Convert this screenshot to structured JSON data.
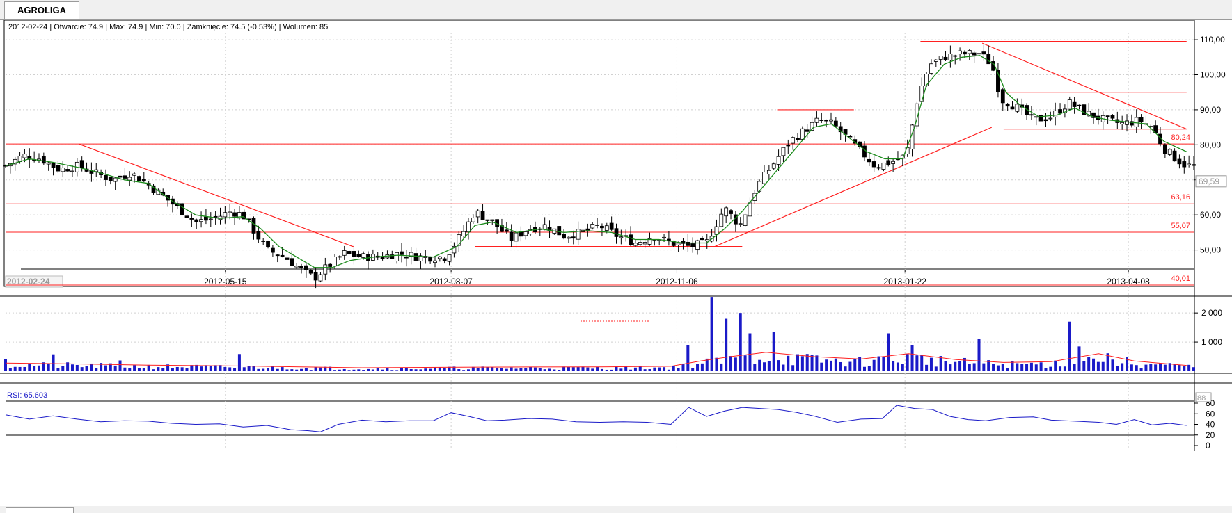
{
  "tab": {
    "label": "AGROLIGA"
  },
  "info_bar": {
    "text": "2012-02-24 | Otwarcie: 74.9 | Max: 74.9 | Min: 70.0 | Zamknięcie: 74.5 (-0.53%) | Wolumen: 85"
  },
  "chart_data": [
    {
      "type": "candlestick",
      "title": "",
      "ylim": [
        40,
        112
      ],
      "y_ticks": [
        "110,00",
        "100,00",
        "90,00",
        "80,00",
        "70,00",
        "60,00",
        "50,00"
      ],
      "x_ticks": [
        "2012-05-15",
        "2012-08-07",
        "2012-11-06",
        "2013-01-22",
        "2013-04-08"
      ],
      "x_start_label": "2012-02-24",
      "last_price_label": "69,59",
      "levels": [
        {
          "label": "80,24",
          "value": 80.24
        },
        {
          "label": "63,16",
          "value": 63.16
        },
        {
          "label": "55,07",
          "value": 55.07
        },
        {
          "label": "40,01",
          "value": 40.01
        }
      ],
      "trendlines": [
        {
          "from": [
            0.062,
            80.2
          ],
          "to": [
            0.293,
            50.9
          ]
        },
        {
          "from": [
            0.395,
            51.0
          ],
          "to": [
            0.62,
            51.0
          ]
        },
        {
          "from": [
            0.65,
            90.0
          ],
          "to": [
            0.714,
            90.0
          ]
        },
        {
          "from": [
            0.597,
            51.0
          ],
          "to": [
            0.83,
            85.0
          ]
        },
        {
          "from": [
            0.77,
            109.5
          ],
          "to": [
            0.994,
            109.5
          ]
        },
        {
          "from": [
            0.822,
            109.0
          ],
          "to": [
            0.994,
            84.5
          ]
        },
        {
          "from": [
            0.84,
            95.0
          ],
          "to": [
            0.994,
            95.0
          ]
        },
        {
          "from": [
            0.84,
            84.5
          ],
          "to": [
            0.994,
            84.5
          ]
        }
      ],
      "series": [
        {
          "name": "",
          "kind": "close",
          "points": [
            [
              0,
              74
            ],
            [
              0.015,
              77
            ],
            [
              0.03,
              76
            ],
            [
              0.045,
              73
            ],
            [
              0.062,
              74
            ],
            [
              0.075,
              72
            ],
            [
              0.09,
              70
            ],
            [
              0.105,
              72
            ],
            [
              0.115,
              70
            ],
            [
              0.13,
              66
            ],
            [
              0.145,
              62
            ],
            [
              0.16,
              58
            ],
            [
              0.175,
              59
            ],
            [
              0.19,
              61
            ],
            [
              0.2,
              60
            ],
            [
              0.21,
              55
            ],
            [
              0.22,
              50
            ],
            [
              0.235,
              48
            ],
            [
              0.25,
              44
            ],
            [
              0.26,
              42
            ],
            [
              0.27,
              45
            ],
            [
              0.285,
              49
            ],
            [
              0.3,
              48
            ],
            [
              0.315,
              48
            ],
            [
              0.33,
              49
            ],
            [
              0.35,
              48
            ],
            [
              0.37,
              48
            ],
            [
              0.385,
              55
            ],
            [
              0.395,
              61
            ],
            [
              0.41,
              58
            ],
            [
              0.425,
              53
            ],
            [
              0.44,
              56
            ],
            [
              0.455,
              57
            ],
            [
              0.47,
              54
            ],
            [
              0.485,
              55
            ],
            [
              0.5,
              57
            ],
            [
              0.515,
              54
            ],
            [
              0.53,
              52
            ],
            [
              0.545,
              54
            ],
            [
              0.56,
              52
            ],
            [
              0.575,
              51
            ],
            [
              0.59,
              52
            ],
            [
              0.605,
              62
            ],
            [
              0.618,
              57
            ],
            [
              0.632,
              68
            ],
            [
              0.645,
              74
            ],
            [
              0.66,
              81
            ],
            [
              0.672,
              84
            ],
            [
              0.684,
              87
            ],
            [
              0.696,
              86
            ],
            [
              0.708,
              82
            ],
            [
              0.72,
              78
            ],
            [
              0.732,
              74
            ],
            [
              0.745,
              75
            ],
            [
              0.758,
              77
            ],
            [
              0.768,
              94
            ],
            [
              0.778,
              103
            ],
            [
              0.79,
              105
            ],
            [
              0.805,
              106
            ],
            [
              0.82,
              106
            ],
            [
              0.83,
              103
            ],
            [
              0.838,
              93
            ],
            [
              0.85,
              91
            ],
            [
              0.865,
              87
            ],
            [
              0.88,
              88
            ],
            [
              0.895,
              92
            ],
            [
              0.91,
              89
            ],
            [
              0.925,
              87
            ],
            [
              0.94,
              86
            ],
            [
              0.955,
              87
            ],
            [
              0.965,
              85
            ],
            [
              0.975,
              79
            ],
            [
              0.985,
              76
            ],
            [
              0.994,
              74
            ]
          ]
        },
        {
          "name": "",
          "kind": "average",
          "points": [
            [
              0,
              74
            ],
            [
              0.02,
              76
            ],
            [
              0.04,
              75
            ],
            [
              0.062,
              73.5
            ],
            [
              0.08,
              72
            ],
            [
              0.1,
              70
            ],
            [
              0.12,
              69
            ],
            [
              0.14,
              64
            ],
            [
              0.16,
              60
            ],
            [
              0.18,
              59
            ],
            [
              0.2,
              59.5
            ],
            [
              0.215,
              56
            ],
            [
              0.23,
              51
            ],
            [
              0.245,
              48
            ],
            [
              0.26,
              45
            ],
            [
              0.275,
              45
            ],
            [
              0.29,
              47
            ],
            [
              0.31,
              48
            ],
            [
              0.33,
              48.5
            ],
            [
              0.36,
              48
            ],
            [
              0.38,
              51
            ],
            [
              0.395,
              57
            ],
            [
              0.41,
              58
            ],
            [
              0.43,
              55
            ],
            [
              0.45,
              56
            ],
            [
              0.47,
              55
            ],
            [
              0.49,
              55.5
            ],
            [
              0.51,
              55
            ],
            [
              0.53,
              53
            ],
            [
              0.55,
              53
            ],
            [
              0.57,
              52
            ],
            [
              0.59,
              52
            ],
            [
              0.605,
              56
            ],
            [
              0.62,
              61
            ],
            [
              0.635,
              67
            ],
            [
              0.65,
              73
            ],
            [
              0.665,
              79
            ],
            [
              0.68,
              85
            ],
            [
              0.695,
              86
            ],
            [
              0.71,
              82
            ],
            [
              0.725,
              78
            ],
            [
              0.74,
              76
            ],
            [
              0.755,
              76
            ],
            [
              0.765,
              85
            ],
            [
              0.775,
              97
            ],
            [
              0.79,
              103
            ],
            [
              0.805,
              105
            ],
            [
              0.82,
              105.5
            ],
            [
              0.832,
              103
            ],
            [
              0.842,
              95
            ],
            [
              0.855,
              91
            ],
            [
              0.87,
              88
            ],
            [
              0.885,
              88.5
            ],
            [
              0.9,
              90.5
            ],
            [
              0.915,
              88
            ],
            [
              0.93,
              87
            ],
            [
              0.945,
              86.5
            ],
            [
              0.96,
              86
            ],
            [
              0.975,
              81
            ],
            [
              0.994,
              78
            ]
          ]
        }
      ]
    },
    {
      "type": "bar",
      "title": "",
      "ylim": [
        0,
        2600
      ],
      "y_ticks": [
        "2 000",
        "1 000"
      ],
      "tick_values": [
        2000,
        1000
      ],
      "spikes": [
        [
          0.0,
          420
        ],
        [
          0.041,
          580
        ],
        [
          0.095,
          370
        ],
        [
          0.195,
          590
        ],
        [
          0.575,
          900
        ],
        [
          0.595,
          2550
        ],
        [
          0.606,
          1800
        ],
        [
          0.617,
          2000
        ],
        [
          0.627,
          1300
        ],
        [
          0.648,
          1350
        ],
        [
          0.742,
          1300
        ],
        [
          0.762,
          900
        ],
        [
          0.82,
          1100
        ],
        [
          0.896,
          1700
        ],
        [
          0.905,
          850
        ],
        [
          0.932,
          400
        ]
      ],
      "ma": [
        [
          0,
          280
        ],
        [
          0.06,
          250
        ],
        [
          0.12,
          210
        ],
        [
          0.2,
          180
        ],
        [
          0.3,
          120
        ],
        [
          0.4,
          140
        ],
        [
          0.5,
          150
        ],
        [
          0.56,
          170
        ],
        [
          0.585,
          350
        ],
        [
          0.61,
          500
        ],
        [
          0.64,
          650
        ],
        [
          0.68,
          500
        ],
        [
          0.72,
          420
        ],
        [
          0.76,
          600
        ],
        [
          0.8,
          400
        ],
        [
          0.84,
          300
        ],
        [
          0.88,
          330
        ],
        [
          0.92,
          600
        ],
        [
          0.95,
          350
        ],
        [
          0.994,
          200
        ]
      ]
    },
    {
      "type": "line",
      "title": "",
      "label": "RSI: 65.603",
      "value_badge": "88",
      "ylim": [
        0,
        80
      ],
      "y_ticks": [
        "80",
        "60",
        "40",
        "20",
        "0"
      ],
      "tick_values": [
        80,
        60,
        40,
        20,
        0
      ],
      "points": [
        [
          0,
          58
        ],
        [
          0.02,
          50
        ],
        [
          0.04,
          56
        ],
        [
          0.06,
          50
        ],
        [
          0.08,
          45
        ],
        [
          0.1,
          47
        ],
        [
          0.12,
          46
        ],
        [
          0.14,
          42
        ],
        [
          0.16,
          40
        ],
        [
          0.18,
          41
        ],
        [
          0.2,
          35
        ],
        [
          0.22,
          38
        ],
        [
          0.24,
          30
        ],
        [
          0.255,
          28
        ],
        [
          0.265,
          26
        ],
        [
          0.28,
          40
        ],
        [
          0.3,
          48
        ],
        [
          0.32,
          45
        ],
        [
          0.34,
          47
        ],
        [
          0.36,
          47
        ],
        [
          0.375,
          62
        ],
        [
          0.39,
          55
        ],
        [
          0.405,
          47
        ],
        [
          0.42,
          48
        ],
        [
          0.44,
          51
        ],
        [
          0.46,
          50
        ],
        [
          0.48,
          45
        ],
        [
          0.5,
          44
        ],
        [
          0.52,
          45
        ],
        [
          0.54,
          44
        ],
        [
          0.56,
          40
        ],
        [
          0.575,
          72
        ],
        [
          0.59,
          55
        ],
        [
          0.605,
          65
        ],
        [
          0.62,
          72
        ],
        [
          0.635,
          70
        ],
        [
          0.65,
          68
        ],
        [
          0.665,
          63
        ],
        [
          0.68,
          56
        ],
        [
          0.7,
          44
        ],
        [
          0.72,
          50
        ],
        [
          0.738,
          51
        ],
        [
          0.75,
          76
        ],
        [
          0.765,
          70
        ],
        [
          0.78,
          68
        ],
        [
          0.795,
          55
        ],
        [
          0.81,
          49
        ],
        [
          0.825,
          47
        ],
        [
          0.845,
          53
        ],
        [
          0.865,
          54
        ],
        [
          0.88,
          48
        ],
        [
          0.9,
          46
        ],
        [
          0.92,
          44
        ],
        [
          0.935,
          40
        ],
        [
          0.95,
          49
        ],
        [
          0.965,
          39
        ],
        [
          0.98,
          42
        ],
        [
          0.994,
          38
        ]
      ]
    }
  ],
  "colors": {
    "candle_up": "#ffffff",
    "candle_down": "#000000",
    "levels": "#ff2020",
    "average": "#1a8a1a",
    "volume": "#1a1ac8",
    "volume_ma": "#ff2020",
    "rsi": "#1a1ac8"
  }
}
